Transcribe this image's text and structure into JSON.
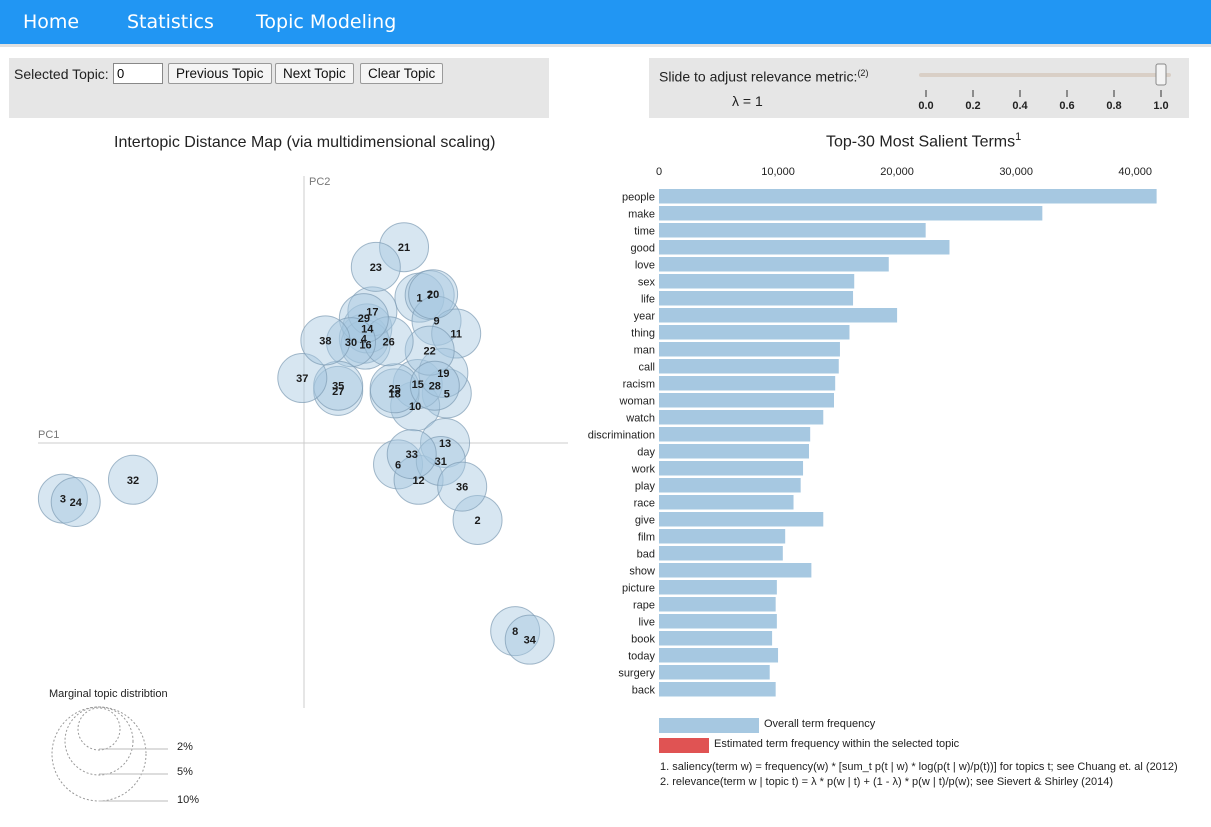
{
  "nav": {
    "items": [
      "Home",
      "Statistics",
      "Topic Modeling"
    ]
  },
  "controls": {
    "selected_topic_label": "Selected Topic:",
    "selected_topic_value": "0",
    "previous": "Previous Topic",
    "next": "Next Topic",
    "clear": "Clear Topic"
  },
  "relevance": {
    "label": "Slide to adjust relevance metric:",
    "footnote_ref": "(2)",
    "lambda_text": "λ = 1",
    "lambda": 1.0,
    "ticks": [
      "0.0",
      "0.2",
      "0.4",
      "0.6",
      "0.8",
      "1.0"
    ]
  },
  "left_title": "Intertopic Distance Map (via multidimensional scaling)",
  "right_title": "Top-30 Most Salient Terms",
  "right_title_sup": "1",
  "axes": {
    "pc1": "PC1",
    "pc2": "PC2"
  },
  "marginal": {
    "title": "Marginal topic distribtion",
    "labels": [
      "2%",
      "5%",
      "10%"
    ]
  },
  "legend": {
    "overall": "Overall term frequency",
    "estimated": "Estimated term frequency within the selected topic"
  },
  "footnotes": {
    "saliency": "1. saliency(term w) = frequency(w) * [sum_t p(t | w) * log(p(t | w)/p(t))] for topics t; see Chuang et. al (2012)",
    "relevance": "2. relevance(term w | topic t) = λ * p(w | t) + (1 - λ) * p(w | t)/p(w); see Sievert & Shirley (2014)"
  },
  "colors": {
    "navbar": "#2196f3",
    "bar": "#a6c8e1",
    "selected_bar": "#e05353",
    "circle_fill": "#a6c8e1",
    "circle_stroke": "#7d9bb4"
  },
  "chart_data": [
    {
      "type": "scatter",
      "title": "Intertopic Distance Map (via multidimensional scaling)",
      "xlabel": "PC1",
      "ylabel": "PC2",
      "xlim": [
        -0.31,
        0.31
      ],
      "ylim": [
        -0.31,
        0.31
      ],
      "points": [
        {
          "label": "1",
          "x": 0.135,
          "y": 0.17
        },
        {
          "label": "2",
          "x": 0.203,
          "y": -0.09
        },
        {
          "label": "3",
          "x": -0.282,
          "y": -0.065
        },
        {
          "label": "4",
          "x": 0.07,
          "y": 0.122
        },
        {
          "label": "5",
          "x": 0.167,
          "y": 0.058
        },
        {
          "label": "6",
          "x": 0.11,
          "y": -0.025
        },
        {
          "label": "7",
          "x": 0.147,
          "y": 0.173
        },
        {
          "label": "8",
          "x": 0.247,
          "y": -0.22
        },
        {
          "label": "9",
          "x": 0.155,
          "y": 0.143
        },
        {
          "label": "10",
          "x": 0.13,
          "y": 0.043
        },
        {
          "label": "11",
          "x": 0.178,
          "y": 0.128
        },
        {
          "label": "12",
          "x": 0.134,
          "y": -0.043
        },
        {
          "label": "13",
          "x": 0.165,
          "y": 0.0
        },
        {
          "label": "14",
          "x": 0.074,
          "y": 0.134
        },
        {
          "label": "15",
          "x": 0.133,
          "y": 0.069
        },
        {
          "label": "16",
          "x": 0.072,
          "y": 0.115
        },
        {
          "label": "17",
          "x": 0.08,
          "y": 0.154
        },
        {
          "label": "18",
          "x": 0.106,
          "y": 0.058
        },
        {
          "label": "19",
          "x": 0.163,
          "y": 0.082
        },
        {
          "label": "20",
          "x": 0.151,
          "y": 0.174
        },
        {
          "label": "21",
          "x": 0.117,
          "y": 0.229
        },
        {
          "label": "22",
          "x": 0.147,
          "y": 0.108
        },
        {
          "label": "23",
          "x": 0.084,
          "y": 0.206
        },
        {
          "label": "24",
          "x": -0.267,
          "y": -0.069
        },
        {
          "label": "25",
          "x": 0.106,
          "y": 0.064
        },
        {
          "label": "26",
          "x": 0.099,
          "y": 0.119
        },
        {
          "label": "27",
          "x": 0.04,
          "y": 0.061
        },
        {
          "label": "28",
          "x": 0.153,
          "y": 0.067
        },
        {
          "label": "29",
          "x": 0.07,
          "y": 0.146
        },
        {
          "label": "30",
          "x": 0.055,
          "y": 0.118
        },
        {
          "label": "31",
          "x": 0.16,
          "y": -0.021
        },
        {
          "label": "32",
          "x": -0.2,
          "y": -0.043
        },
        {
          "label": "33",
          "x": 0.126,
          "y": -0.013
        },
        {
          "label": "34",
          "x": 0.264,
          "y": -0.23
        },
        {
          "label": "35",
          "x": 0.04,
          "y": 0.067
        },
        {
          "label": "36",
          "x": 0.185,
          "y": -0.051
        },
        {
          "label": "37",
          "x": -0.002,
          "y": 0.076
        },
        {
          "label": "38",
          "x": 0.025,
          "y": 0.12
        }
      ]
    },
    {
      "type": "bar",
      "orientation": "horizontal",
      "title": "Top-30 Most Salient Terms",
      "xlim": [
        0,
        42000
      ],
      "xticks": [
        0,
        10000,
        20000,
        30000,
        40000
      ],
      "xtick_labels": [
        "0",
        "10,000",
        "20,000",
        "30,000",
        "40,000"
      ],
      "categories": [
        "people",
        "make",
        "time",
        "good",
        "love",
        "sex",
        "life",
        "year",
        "thing",
        "man",
        "call",
        "racism",
        "woman",
        "watch",
        "discrimination",
        "day",
        "work",
        "play",
        "race",
        "give",
        "film",
        "bad",
        "show",
        "picture",
        "rape",
        "live",
        "book",
        "today",
        "surgery",
        "back"
      ],
      "series": [
        {
          "name": "Overall term frequency",
          "values": [
            41800,
            32200,
            22400,
            24400,
            19300,
            16400,
            16300,
            20000,
            16000,
            15200,
            15100,
            14800,
            14700,
            13800,
            12700,
            12600,
            12100,
            11900,
            11300,
            13800,
            10600,
            10400,
            12800,
            9900,
            9800,
            9900,
            9500,
            10000,
            9300,
            9800
          ]
        }
      ],
      "legend": [
        "Overall term frequency",
        "Estimated term frequency within the selected topic"
      ]
    }
  ]
}
